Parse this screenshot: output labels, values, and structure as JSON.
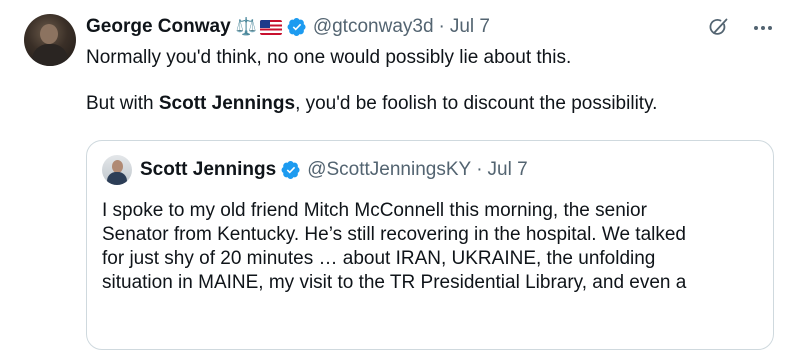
{
  "tweet": {
    "author_name": "George Conway",
    "author_emoji": "⚖️",
    "handle": "@gtconway3d",
    "separator": "·",
    "date": "Jul 7",
    "text_line1": "Normally you'd think, no one would possibly lie about this.",
    "text_line2_prefix": "But with ",
    "text_line2_bold": "Scott Jennings",
    "text_line2_suffix": ", you'd be foolish to discount the possibility."
  },
  "actions": {
    "grok_icon": "grok-icon",
    "more_icon": "more-icon",
    "more_label": "···"
  },
  "quote": {
    "author_name": "Scott Jennings",
    "handle": "@ScottJenningsKY",
    "separator": "·",
    "date": "Jul 7",
    "lines": [
      "I spoke to my old friend Mitch McConnell this morning, the senior",
      "Senator from Kentucky. He’s still recovering in the hospital. We talked",
      "for just shy of 20 minutes … about IRAN, UKRAINE, the unfolding",
      "situation in MAINE, my visit to the TR Presidential Library, and even a"
    ]
  },
  "colors": {
    "verified": "#1d9bf0",
    "secondary_text": "#536471",
    "border": "#cfd9de"
  }
}
